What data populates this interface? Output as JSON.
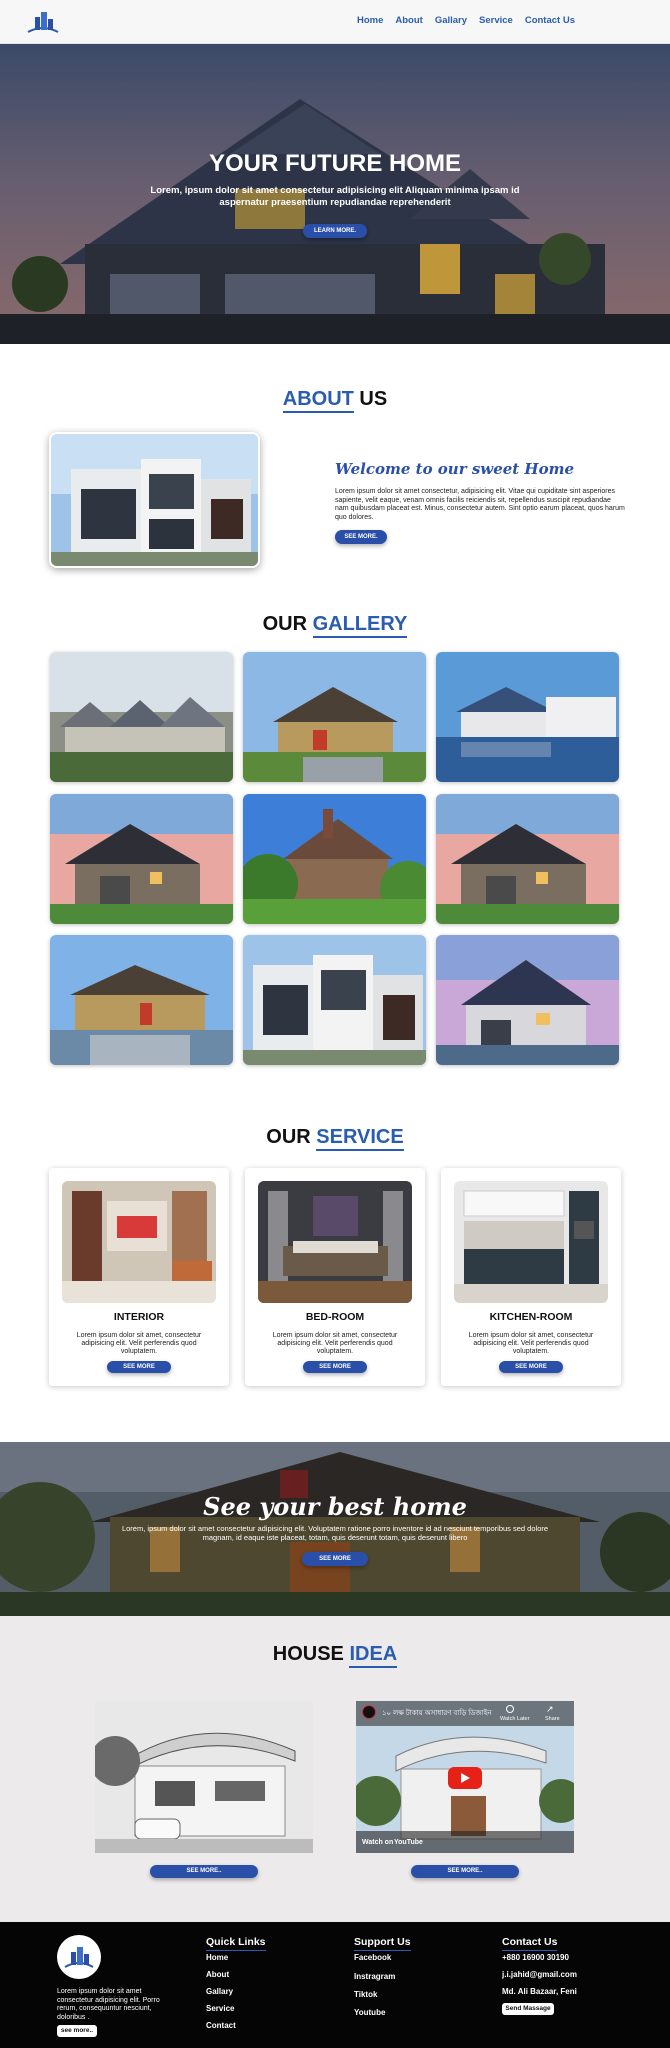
{
  "nav": {
    "links": [
      "Home",
      "About",
      "Gallary",
      "Service",
      "Contact Us"
    ]
  },
  "hero": {
    "title": "YOUR FUTURE HOME",
    "subtitle": "Lorem, ipsum dolor sit amet consectetur adipisicing elit Aliquam minima ipsam id aspernatur praesentium repudiandae reprehenderit",
    "button": "LEARN MORE."
  },
  "about": {
    "title_blue": "ABOUT",
    "title_rest": " US",
    "welcome": "Welcome to our sweet Home",
    "text": "Lorem ipsum dolor sit amet consectetur, adipisicing elit. Vitae qui cupiditate sint asperiores sapiente, velit eaque, venam omnis facilis reiciendis sit, repellendus suscipit repudiandae nam quibusdam placeat est. Minus, consectetur autem. Sint optio earum placeat, quos harum quo dolores.",
    "button": "SEE MORE."
  },
  "gallery": {
    "title_rest": "OUR ",
    "title_blue": "GALLERY"
  },
  "service": {
    "title_rest": "OUR ",
    "title_blue": "SERVICE",
    "cards": [
      {
        "title": "INTERIOR",
        "text": "Lorem ipsum dolor sit amet, consectetur adipisicing elit. Velit perferendis quod voluptatem.",
        "button": "SEE MORE"
      },
      {
        "title": "BED-ROOM",
        "text": "Lorem ipsum dolor sit amet, consectetur adipisicing elit. Velit perferendis quod voluptatem.",
        "button": "SEE MORE"
      },
      {
        "title": "KITCHEN-ROOM",
        "text": "Lorem ipsum dolor sit amet, consectetur adipisicing elit. Velit perferendis quod voluptatem.",
        "button": "SEE MORE"
      }
    ]
  },
  "banner": {
    "title": "See your best home",
    "text": "Lorem, ipsum dolor sit amet consectetur adipisicing elit. Voluptatem ratione porro inventore id ad nesciunt temporibus sed dolore magnam, id eaque iste placeat, totam, quis deserunt totam, quis deserunt libero",
    "button": "SEE MORE"
  },
  "idea": {
    "title_rest": "HOUSE ",
    "title_blue": "IDEA",
    "button_left": "SEE MORE..",
    "button_right": "SEE MORE..",
    "video": {
      "title": "১০ লক্ষ টাকায় অসাধারণ বাড়ি ডিজাইন",
      "watch_later": "Watch Later",
      "share": "Share",
      "watch_on": "Watch on",
      "youtube": "YouTube"
    }
  },
  "footer": {
    "about_text": "Lorem ipsum dolor sit amet consectetur adipisicing elit. Porro rerum, consequuntur nesciunt, doloribus .",
    "about_button": "see more..",
    "quick_links": {
      "heading": "Quick Links",
      "items": [
        "Home",
        "About",
        "Gallary",
        "Service",
        "Contact"
      ]
    },
    "support": {
      "heading": "Support Us",
      "items": [
        "Facebook",
        "Instragram",
        "Tiktok",
        "Youtube"
      ]
    },
    "contact": {
      "heading": "Contact Us",
      "phone": "+880 16900 30190",
      "email": "j.i.jahid@gmail.com",
      "address": "Md. Ali Bazaar, Feni",
      "button": "Send Massage"
    }
  },
  "colors": {
    "accent": "#2a5db0",
    "button": "#2a4fa8",
    "footer_bg": "#050505",
    "idea_bg": "#eceaea"
  }
}
